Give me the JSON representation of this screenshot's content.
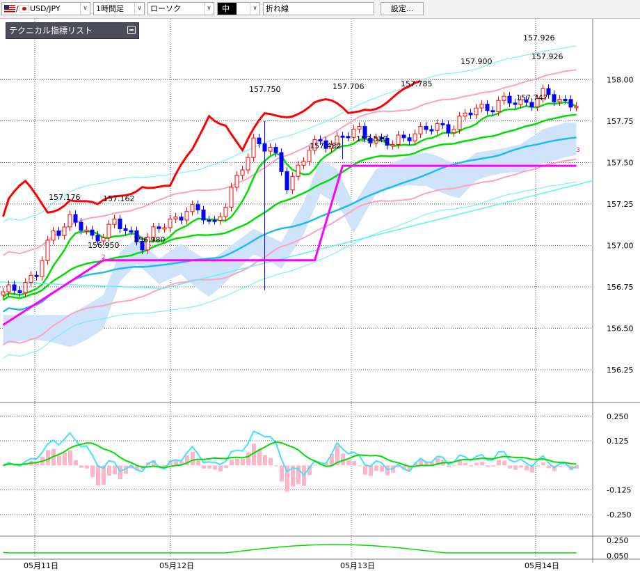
{
  "toolbar": {
    "symbol": "USD/JPY",
    "timeframe": "1時間足",
    "chart_type": "ローソク",
    "size": "中",
    "overlay": "折れ線",
    "settings_label": "設定..."
  },
  "indicator_list_label": "テクニカル指標リスト",
  "colors": {
    "up_candle": "#ffffff",
    "up_candle_border": "#ff0000",
    "down_candle": "#0000ff",
    "sma_short": "#1ebbf0",
    "sma_mid": "#00dd00",
    "bollinger_2": "#ffa0c0",
    "bollinger_3": "#60f0ff",
    "rci_line": "#ff0000",
    "zigzag": "#ff00ff",
    "ichimoku_cloud": "#cfe4fb",
    "macd": "#40e0ff",
    "signal": "#00dd00",
    "histogram": "#ffb6c8"
  },
  "chart_data": {
    "type": "line",
    "main_panel": {
      "y_ticks": [
        "158.00",
        "157.75",
        "157.50",
        "157.25",
        "157.00",
        "156.75",
        "156.50",
        "156.25"
      ],
      "ylim": [
        156.17,
        158.27
      ],
      "price_annotations": [
        "157.176",
        "157.162",
        "156.950",
        "156.980",
        "157.750",
        "157.706",
        "157.482",
        "157.520",
        "157.785",
        "157.900",
        "157.926",
        "157.926",
        "157.747"
      ],
      "wave_labels": [
        "2",
        "3"
      ],
      "zigzag_points": [
        {
          "bar": 0,
          "price": 156.52
        },
        {
          "bar": 18,
          "price": 156.91
        },
        {
          "bar": 56,
          "price": 156.91
        },
        {
          "bar": 61,
          "price": 157.48
        },
        {
          "bar": 103,
          "price": 157.48
        }
      ]
    },
    "macd_panel": {
      "y_ticks": [
        "0.250",
        "0.125",
        "-0.125",
        "-0.250"
      ],
      "ylim": [
        -0.36,
        0.32
      ]
    },
    "bottom_panel": {
      "y_ticks": [
        "0.250",
        "0.050"
      ]
    },
    "x_tick_labels": [
      "05月11日",
      "05月12日",
      "05月13日",
      "05月14日"
    ]
  }
}
